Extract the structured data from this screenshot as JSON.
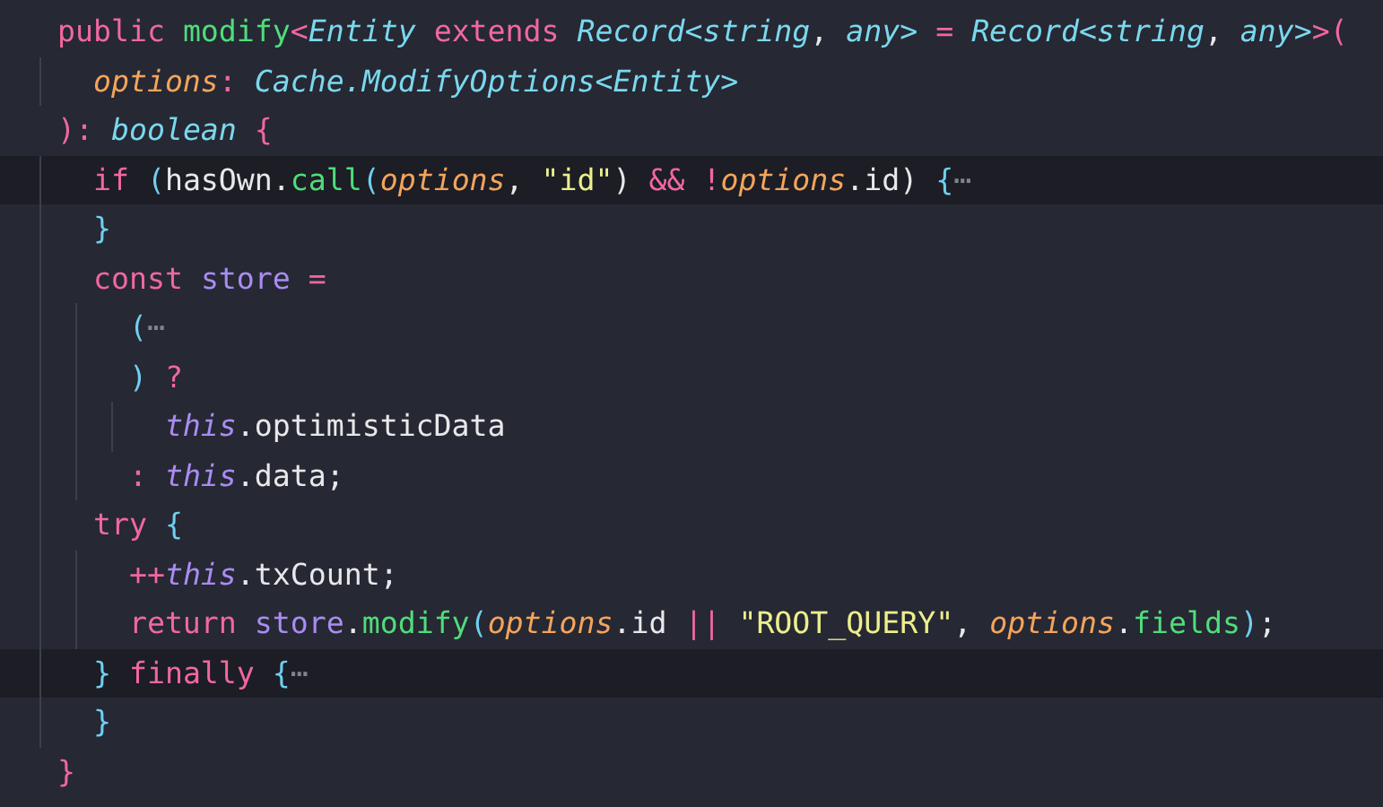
{
  "editor": {
    "lines": [
      {
        "highlighted": false,
        "tokens": [
          {
            "kind": "keyword",
            "text": "public "
          },
          {
            "kind": "function",
            "text": "modify"
          },
          {
            "kind": "operator",
            "text": "<"
          },
          {
            "kind": "type",
            "text": "Entity "
          },
          {
            "kind": "keyword",
            "text": "extends "
          },
          {
            "kind": "type",
            "text": "Record<string"
          },
          {
            "kind": "plain",
            "text": ", "
          },
          {
            "kind": "type",
            "text": "any> "
          },
          {
            "kind": "operator",
            "text": "= "
          },
          {
            "kind": "type",
            "text": "Record<string"
          },
          {
            "kind": "plain",
            "text": ", "
          },
          {
            "kind": "type",
            "text": "any>"
          },
          {
            "kind": "operator",
            "text": ">("
          }
        ]
      },
      {
        "highlighted": false,
        "tokens": [
          {
            "kind": "param",
            "text": "  options"
          },
          {
            "kind": "operator",
            "text": ": "
          },
          {
            "kind": "type",
            "text": "Cache.ModifyOptions<Entity>"
          }
        ]
      },
      {
        "highlighted": false,
        "tokens": [
          {
            "kind": "operator",
            "text": "): "
          },
          {
            "kind": "type",
            "text": "boolean "
          },
          {
            "kind": "operator",
            "text": "{"
          }
        ]
      },
      {
        "highlighted": true,
        "tokens": [
          {
            "kind": "keyword",
            "text": "  if "
          },
          {
            "kind": "brace",
            "text": "("
          },
          {
            "kind": "plain",
            "text": "hasOwn."
          },
          {
            "kind": "function",
            "text": "call"
          },
          {
            "kind": "brace",
            "text": "("
          },
          {
            "kind": "param",
            "text": "options"
          },
          {
            "kind": "plain",
            "text": ", "
          },
          {
            "kind": "string",
            "text": "\"id\""
          },
          {
            "kind": "plain",
            "text": ") "
          },
          {
            "kind": "operator",
            "text": "&& !"
          },
          {
            "kind": "param",
            "text": "options"
          },
          {
            "kind": "plain",
            "text": ".id) "
          },
          {
            "kind": "brace",
            "text": "{"
          },
          {
            "kind": "fold",
            "text": "⋯"
          }
        ]
      },
      {
        "highlighted": false,
        "tokens": [
          {
            "kind": "brace",
            "text": "  }"
          }
        ]
      },
      {
        "highlighted": false,
        "tokens": [
          {
            "kind": "keyword",
            "text": "  const "
          },
          {
            "kind": "variable",
            "text": "store "
          },
          {
            "kind": "operator",
            "text": "="
          }
        ]
      },
      {
        "highlighted": false,
        "tokens": [
          {
            "kind": "brace",
            "text": "    ("
          },
          {
            "kind": "fold",
            "text": "⋯"
          }
        ]
      },
      {
        "highlighted": false,
        "tokens": [
          {
            "kind": "brace",
            "text": "    ) "
          },
          {
            "kind": "operator",
            "text": "?"
          }
        ]
      },
      {
        "highlighted": false,
        "tokens": [
          {
            "kind": "this",
            "text": "      this"
          },
          {
            "kind": "plain",
            "text": ".optimisticData"
          }
        ]
      },
      {
        "highlighted": false,
        "tokens": [
          {
            "kind": "operator",
            "text": "    : "
          },
          {
            "kind": "this",
            "text": "this"
          },
          {
            "kind": "plain",
            "text": ".data;"
          }
        ]
      },
      {
        "highlighted": false,
        "tokens": [
          {
            "kind": "keyword",
            "text": "  try "
          },
          {
            "kind": "brace",
            "text": "{"
          }
        ]
      },
      {
        "highlighted": false,
        "tokens": [
          {
            "kind": "operator",
            "text": "    ++"
          },
          {
            "kind": "this",
            "text": "this"
          },
          {
            "kind": "plain",
            "text": ".txCount;"
          }
        ]
      },
      {
        "highlighted": false,
        "tokens": [
          {
            "kind": "keyword",
            "text": "    return "
          },
          {
            "kind": "variable",
            "text": "store"
          },
          {
            "kind": "plain",
            "text": "."
          },
          {
            "kind": "function",
            "text": "modify"
          },
          {
            "kind": "brace",
            "text": "("
          },
          {
            "kind": "param",
            "text": "options"
          },
          {
            "kind": "plain",
            "text": ".id "
          },
          {
            "kind": "operator",
            "text": "|| "
          },
          {
            "kind": "string",
            "text": "\"ROOT_QUERY\""
          },
          {
            "kind": "plain",
            "text": ", "
          },
          {
            "kind": "param",
            "text": "options"
          },
          {
            "kind": "plain",
            "text": "."
          },
          {
            "kind": "function",
            "text": "fields"
          },
          {
            "kind": "brace",
            "text": ")"
          },
          {
            "kind": "plain",
            "text": ";"
          }
        ]
      },
      {
        "highlighted": true,
        "tokens": [
          {
            "kind": "brace",
            "text": "  } "
          },
          {
            "kind": "keyword",
            "text": "finally "
          },
          {
            "kind": "brace",
            "text": "{"
          },
          {
            "kind": "fold",
            "text": "⋯"
          }
        ]
      },
      {
        "highlighted": false,
        "tokens": [
          {
            "kind": "brace",
            "text": "  }"
          }
        ]
      },
      {
        "highlighted": false,
        "tokens": [
          {
            "kind": "operator",
            "text": "}"
          }
        ]
      }
    ]
  }
}
